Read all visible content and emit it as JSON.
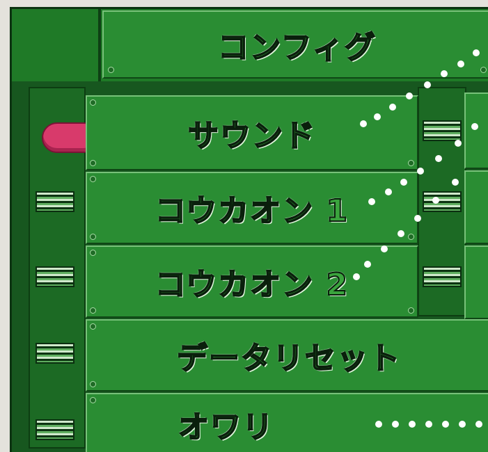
{
  "screen": {
    "title": "コンフィグ",
    "menu_items": [
      {
        "id": "sound",
        "label": "サウンド",
        "selected": true
      },
      {
        "id": "sound_effect_1",
        "label": "コウカオン 1",
        "selected": false
      },
      {
        "id": "sound_effect_2",
        "label": "コウカオン 2",
        "selected": false
      },
      {
        "id": "data_reset",
        "label": "データリセット",
        "selected": false
      },
      {
        "id": "exit",
        "label": "オワリ",
        "selected": false
      }
    ]
  },
  "colors": {
    "board": "#17571f",
    "plate": "#2a8d33",
    "cursor": "#d83a6b",
    "dots": "#ffffff"
  },
  "icons": {
    "cursor": "pink-oval-cursor-icon",
    "connector": "circuit-connector-icon"
  }
}
